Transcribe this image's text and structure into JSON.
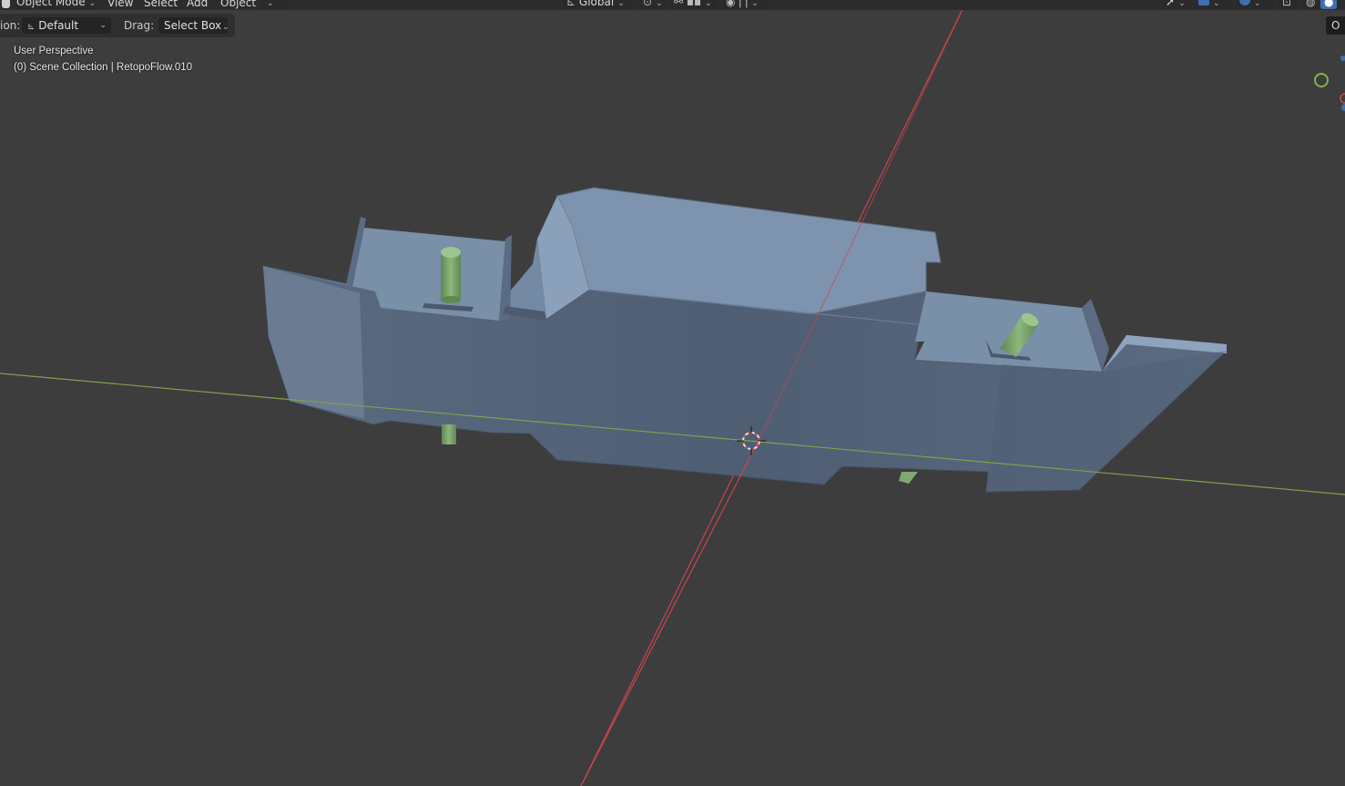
{
  "header": {
    "mode_dropdown": "Object Mode",
    "menus": [
      "View",
      "Select",
      "Add",
      "Object"
    ],
    "orientation_dropdown": "Global"
  },
  "tool_settings": {
    "orientation_label": "ion:",
    "orientation_value": "Default",
    "drag_label": "Drag:",
    "drag_value": "Select Box"
  },
  "viewport_overlay": {
    "view_name": "User Perspective",
    "collection_info": "(0) Scene Collection | RetopoFlow.010"
  },
  "right_tab_label": "O",
  "colors": {
    "background": "#3d3d3d",
    "header": "#2c2c2c",
    "x_axis": "#c8454d",
    "y_axis": "#7ea24a",
    "mesh": "#7a8ca3",
    "peg": "#7fa871"
  },
  "icons": [
    "object-mode-icon",
    "orientation-icon",
    "pivot-icon",
    "snap-icon",
    "proportional-icon",
    "select-tool-icon",
    "gizmo-icon",
    "overlay-icon",
    "xray-icon",
    "wireframe-shading-icon",
    "solid-shading-icon",
    "navigation-gizmo-y-icon",
    "3d-cursor-icon"
  ]
}
